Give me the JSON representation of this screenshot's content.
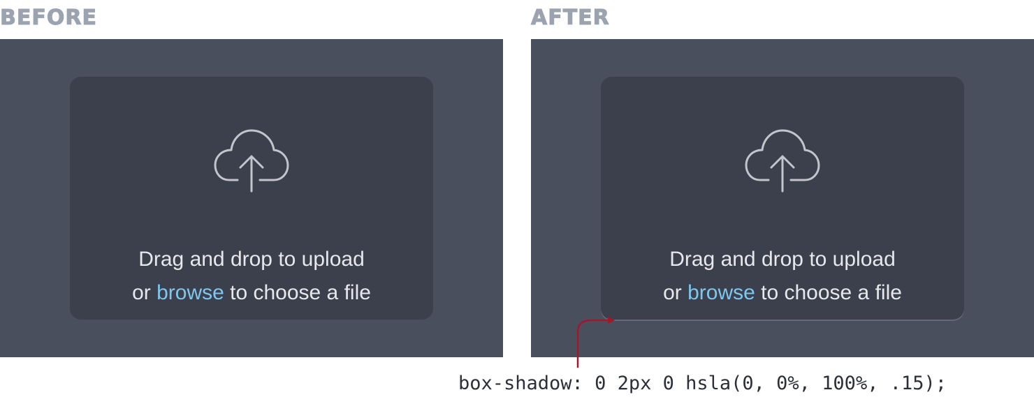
{
  "labels": {
    "before": "BEFORE",
    "after": "AFTER"
  },
  "dropzone": {
    "line1": "Drag and drop to upload",
    "line2_prefix": "or ",
    "line2_link": "browse",
    "line2_suffix": " to choose a file",
    "icon": "cloud-upload-icon"
  },
  "annotation": {
    "code": "box-shadow: 0 2px 0 hsla(0, 0%, 100%, .15);"
  },
  "colors": {
    "panel_background": "#4a4f5e",
    "dropzone_background": "#3c3f4c",
    "text": "#e7e8ec",
    "link": "#7ec8ef",
    "icon": "#c3c5cc",
    "arrow": "#a3172b",
    "label": "#9ca3b0"
  }
}
